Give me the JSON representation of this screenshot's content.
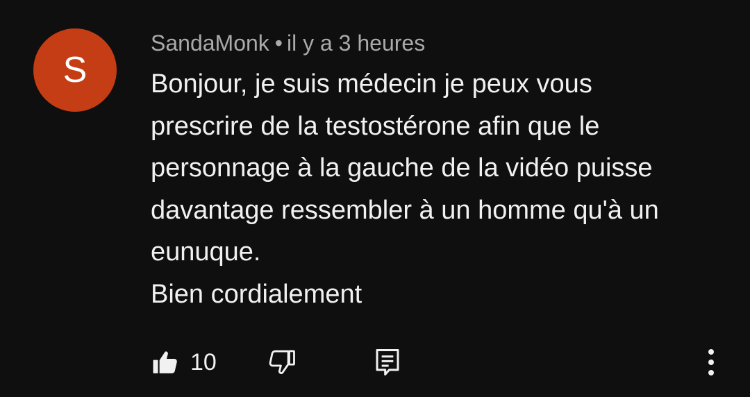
{
  "comment": {
    "avatar_letter": "S",
    "avatar_color": "#c53d14",
    "author": "SandaMonk",
    "separator": "•",
    "timestamp": "il y a 3 heures",
    "text_lines": [
      "Bonjour, je suis médecin je peux vous",
      "prescrire de la testostérone afin que le",
      "personnage à la gauche de la vidéo puisse",
      "davantage ressembler à un homme qu'à un",
      "eunuque.",
      "Bien cordialement"
    ],
    "actions": {
      "like_icon": "thumbs-up-filled-icon",
      "like_count": "10",
      "dislike_icon": "thumbs-down-outline-icon",
      "reply_icon": "comment-reply-icon",
      "more_icon": "more-vertical-icon"
    }
  },
  "colors": {
    "background": "#0f0f0f",
    "text": "#f1f1f1",
    "meta_text": "#aaaaaa"
  }
}
